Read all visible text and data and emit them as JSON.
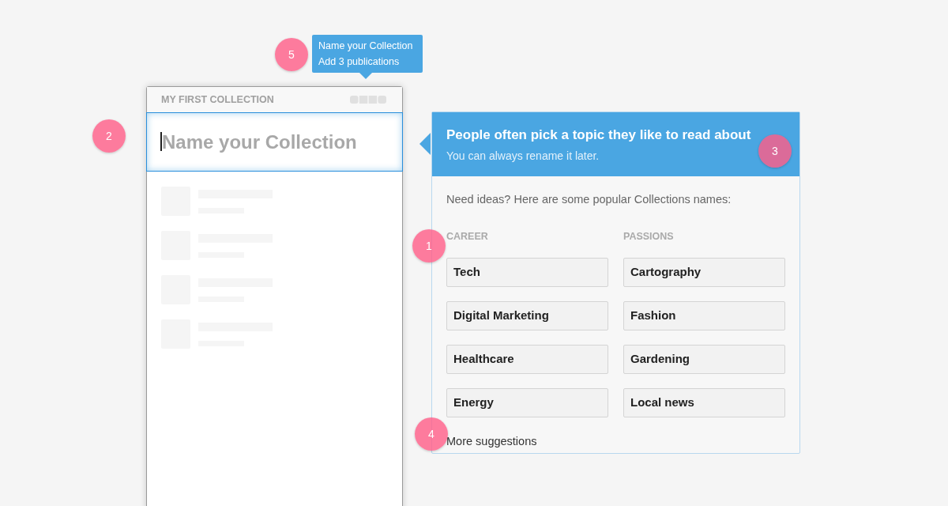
{
  "tooltip": {
    "lines": [
      "Name your Collection",
      "Add 3 publications"
    ]
  },
  "collection_panel": {
    "title": "MY FIRST COLLECTION",
    "name_field": {
      "placeholder": "Name your Collection"
    }
  },
  "suggestion_card": {
    "title": "People often pick a topic they like to read about",
    "subtitle": "You can always rename it later.",
    "intro": "Need ideas? Here are some popular Collections names:",
    "groups": [
      {
        "heading": "CAREER",
        "options": [
          "Tech",
          "Digital Marketing",
          "Healthcare",
          "Energy"
        ]
      },
      {
        "heading": "PASSIONS",
        "options": [
          "Cartography",
          "Fashion",
          "Gardening",
          "Local news"
        ]
      }
    ],
    "more_link": "More suggestions"
  },
  "markers": [
    "1",
    "2",
    "3",
    "4",
    "5"
  ]
}
